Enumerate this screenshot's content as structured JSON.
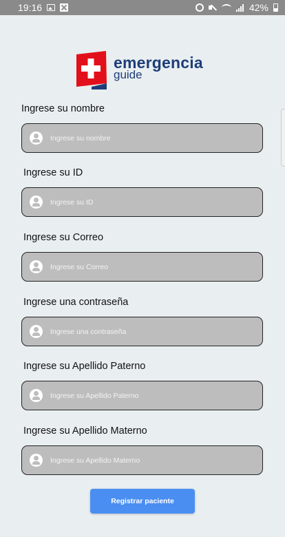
{
  "status_bar": {
    "time": "19:16",
    "battery_percent": "42%",
    "left_icons": [
      "image-icon",
      "close-box-icon"
    ],
    "right_icons": [
      "alarm-icon",
      "mute-icon",
      "wifi-icon",
      "signal-icon",
      "battery-icon"
    ]
  },
  "logo": {
    "word": "emergencia",
    "sub": "guide",
    "brand_red": "#e2101a",
    "brand_blue": "#1d3d79"
  },
  "form": {
    "fields": [
      {
        "label": "Ingrese su nombre",
        "placeholder": "Ingrese su nombre",
        "value": ""
      },
      {
        "label": "Ingrese su ID",
        "placeholder": "Ingrese su ID",
        "value": ""
      },
      {
        "label": "Ingrese su Correo",
        "placeholder": "Ingrese su Correo",
        "value": ""
      },
      {
        "label": "Ingrese una contraseña",
        "placeholder": "Ingrese una contraseña",
        "value": ""
      },
      {
        "label": "Ingrese su Apellido Paterno",
        "placeholder": "Ingrese su Apellido Paterno",
        "value": ""
      },
      {
        "label": "Ingrese su Apellido Materno",
        "placeholder": "Ingrese su Apellido Materno",
        "value": ""
      }
    ],
    "submit_label": "Registrar paciente",
    "submit_color": "#4a8ef2"
  }
}
